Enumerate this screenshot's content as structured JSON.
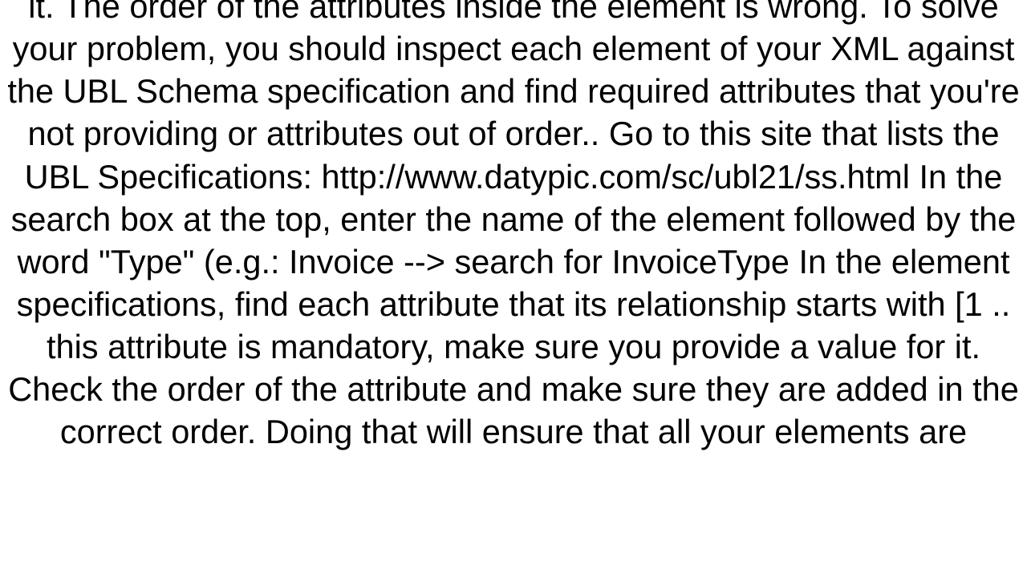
{
  "body": {
    "text": "into two categories:  An Attribute is required but you are not providing it. The order of the attributes inside the element is wrong.  To solve your problem, you should inspect each element of your XML against the UBL Schema specification and find required attributes that you're not providing or attributes out of order..  Go to this site that lists the UBL Specifications: http://www.datypic.com/sc/ubl21/ss.html  In the search box at the top, enter the name of the element followed by the word \"Type\" (e.g.: Invoice --> search for InvoiceType     In the element specifications, find each attribute that its relationship starts with [1 .. this attribute is mandatory, make sure you provide a value for it.  Check the order of the attribute and make sure they are added in the correct order.  Doing that will ensure that all your elements are"
  }
}
